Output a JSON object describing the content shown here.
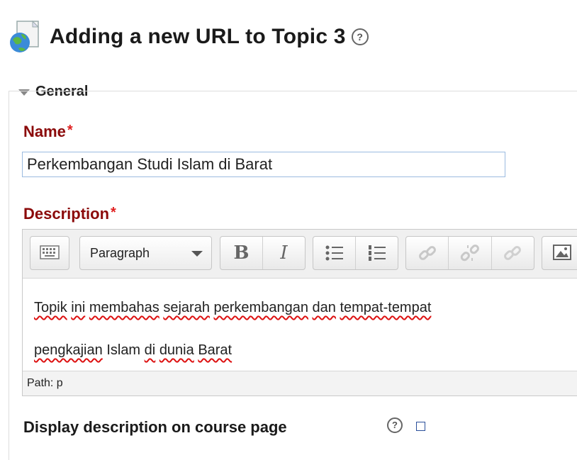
{
  "header": {
    "title": "Adding a new URL to Topic 3",
    "icon": "url-globe-icon",
    "help_symbol": "?"
  },
  "general_section": {
    "legend": "General",
    "name": {
      "label": "Name",
      "required_mark": "*",
      "value": "Perkembangan Studi Islam di Barat"
    },
    "description": {
      "label": "Description",
      "required_mark": "*",
      "toolbar": {
        "format_select": "Paragraph",
        "bold": "B",
        "italic": "I",
        "icons": [
          "toolbar-toggle-icon",
          "bullet-list-icon",
          "numbered-list-icon",
          "link-icon",
          "unlink-icon",
          "nolink-icon",
          "image-icon"
        ]
      },
      "content": {
        "line1": [
          "Topik",
          "ini",
          "membahas",
          "sejarah",
          "perkembangan",
          "dan",
          "tempat-tempat"
        ],
        "line2": [
          "pengkajian",
          "Islam",
          "di",
          "dunia",
          "Barat"
        ]
      },
      "path": "Path: p"
    },
    "display_description": {
      "label": "Display description on course page",
      "checked": false
    }
  },
  "colors": {
    "label_red": "#8b0a0a",
    "required_star": "#e02020",
    "input_border": "#9bbbe0"
  }
}
